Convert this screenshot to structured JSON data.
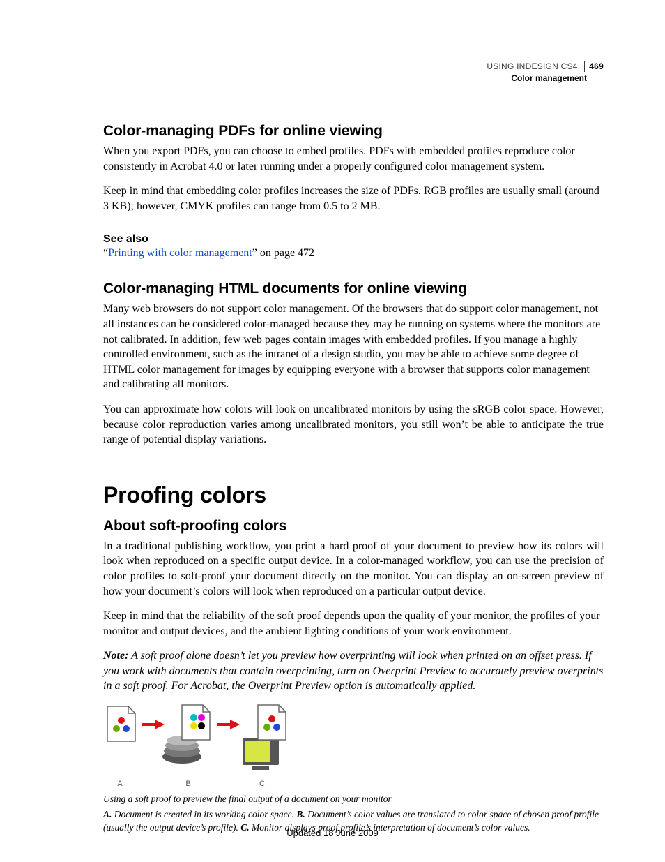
{
  "header": {
    "doc_title": "USING INDESIGN CS4",
    "chapter": "Color management",
    "page_number": "469"
  },
  "sections": {
    "s1": {
      "title": "Color-managing PDFs for online viewing",
      "p1": "When you export PDFs, you can choose to embed profiles. PDFs with embedded profiles reproduce color consistently in Acrobat 4.0 or later running under a properly configured color management system.",
      "p2": "Keep in mind that embedding color profiles increases the size of PDFs. RGB profiles are usually small (around 3 KB); however, CMYK profiles can range from 0.5 to 2 MB."
    },
    "see_also": {
      "title": "See also",
      "q_open": "“",
      "q_close": "”",
      "link_text": "Printing with color management",
      "suffix": " on page 472"
    },
    "s2": {
      "title": "Color-managing HTML documents for online viewing",
      "p1": "Many web browsers do not support color management. Of the browsers that do support color management, not all instances can be considered color-managed because they may be running on systems where the monitors are not calibrated. In addition, few web pages contain images with embedded profiles. If you manage a highly controlled environment, such as the intranet of a design studio, you may be able to achieve some degree of HTML color management for images by equipping everyone with a browser that supports color management and calibrating all monitors.",
      "p2": "You can approximate how colors will look on uncalibrated monitors by using the sRGB color space. However, because color reproduction varies among uncalibrated monitors, you still won’t be able to anticipate the true range of potential display variations."
    },
    "s3_title": "Proofing colors",
    "s4": {
      "title": "About soft-proofing colors",
      "p1": "In a traditional publishing workflow, you print a hard proof of your document to preview how its colors will look when reproduced on a specific output device. In a color-managed workflow, you can use the precision of color profiles to soft-proof your document directly on the monitor. You can display an on-screen preview of how your document’s colors will look when reproduced on a particular output device.",
      "p2": "Keep in mind that the reliability of the soft proof depends upon the quality of your monitor, the profiles of your monitor and output devices, and the ambient lighting conditions of your work environment.",
      "note_lead": "Note:",
      "note_body": " A soft proof alone doesn’t let you preview how overprinting will look when printed on an offset press. If you work with documents that contain overprinting, turn on Overprint Preview to accurately preview overprints in a soft proof. For Acrobat, the Overprint Preview option is automatically applied."
    },
    "figure": {
      "labels": {
        "a": "A",
        "b": "B",
        "c": "C"
      },
      "caption_line1": "Using a soft proof to preview the final output of a document on your monitor",
      "desc_a_lead": "A.",
      "desc_a": " Document is created in its working color space.  ",
      "desc_b_lead": "B.",
      "desc_b": " Document’s color values are translated to color space of chosen proof profile (usually the output device’s profile).  ",
      "desc_c_lead": "C.",
      "desc_c": " Monitor displays proof profile’s interpretation of document’s color values."
    }
  },
  "footer": {
    "updated": "Updated 18 June 2009"
  }
}
